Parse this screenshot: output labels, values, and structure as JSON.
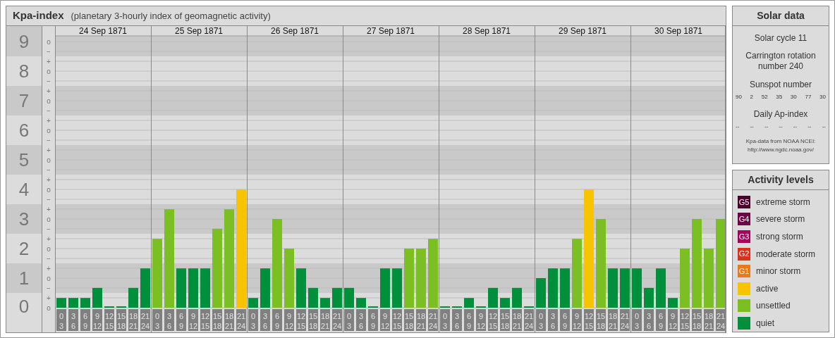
{
  "main_panel": {
    "title": "Kpa-index",
    "subtitle": "(planetary 3-hourly index of geomagnetic activity)",
    "minor_tick_labels": [
      "o",
      "−",
      "+",
      "o",
      "−",
      "+",
      "o",
      "−",
      "+",
      "o",
      "−",
      "+",
      "o",
      "−",
      "+",
      "o",
      "−",
      "+",
      "o",
      "−",
      "+",
      "o",
      "−",
      "+",
      "o",
      "−",
      "+",
      "o"
    ],
    "day_labels": [
      "24 Sep 1871",
      "25 Sep 1871",
      "26 Sep 1871",
      "27 Sep 1871",
      "28 Sep 1871",
      "29 Sep 1871",
      "30 Sep 1871"
    ],
    "chart_data": {
      "type": "bar",
      "stacked": true,
      "ylim": [
        0,
        9
      ],
      "yticks": [
        0,
        1,
        2,
        3,
        4,
        5,
        6,
        7,
        8,
        9
      ],
      "grid": true,
      "categories": [
        "0 3",
        "3 6",
        "6 9",
        "9 12",
        "12 15",
        "15 18",
        "18 21",
        "21 24",
        "0 3",
        "3 6",
        "6 9",
        "9 12",
        "12 15",
        "15 18",
        "18 21",
        "21 24",
        "0 3",
        "3 6",
        "6 9",
        "9 12",
        "12 15",
        "15 18",
        "18 21",
        "21 24",
        "0 3",
        "3 6",
        "6 9",
        "9 12",
        "12 15",
        "15 18",
        "18 21",
        "21 24",
        "0 3",
        "3 6",
        "6 9",
        "9 12",
        "12 15",
        "15 18",
        "18 21",
        "21 24",
        "0 3",
        "3 6",
        "6 9",
        "9 12",
        "12 15",
        "15 18",
        "18 21",
        "21 24",
        "0 3",
        "3 6",
        "6 9",
        "9 12",
        "12 15",
        "15 18",
        "18 21",
        "21 24"
      ],
      "series": [
        {
          "color": "#00903c",
          "values": [
            0.33,
            0.33,
            0.33,
            0.67,
            0,
            0,
            0.67,
            1.33,
            null,
            null,
            1.33,
            1.33,
            1.33,
            null,
            null,
            null,
            0.33,
            1.33,
            null,
            null,
            1.33,
            0.67,
            0.33,
            0.67,
            0.67,
            0.33,
            0,
            1.33,
            1.33,
            null,
            null,
            null,
            0,
            0,
            0.33,
            0,
            0.67,
            0.33,
            0.67,
            0,
            1,
            1.33,
            1.33,
            null,
            null,
            null,
            1.33,
            1.33,
            1.33,
            0.67,
            1.33,
            0.33,
            null,
            null,
            null,
            null
          ]
        },
        {
          "color": "#7cbf22",
          "values": [
            null,
            null,
            null,
            null,
            null,
            null,
            null,
            null,
            2.33,
            3.33,
            null,
            null,
            null,
            2.67,
            3.33,
            null,
            null,
            null,
            3,
            2,
            null,
            null,
            null,
            null,
            null,
            null,
            null,
            null,
            null,
            2,
            2,
            2.33,
            null,
            null,
            null,
            null,
            null,
            null,
            null,
            null,
            null,
            null,
            null,
            2.33,
            null,
            3,
            null,
            null,
            null,
            null,
            null,
            null,
            2,
            3,
            2,
            3
          ]
        },
        {
          "color": "#f8c400",
          "values": [
            null,
            null,
            null,
            null,
            null,
            null,
            null,
            null,
            null,
            null,
            null,
            null,
            null,
            null,
            null,
            4,
            null,
            null,
            null,
            null,
            null,
            null,
            null,
            null,
            null,
            null,
            null,
            null,
            null,
            null,
            null,
            null,
            null,
            null,
            null,
            null,
            null,
            null,
            null,
            null,
            null,
            null,
            null,
            null,
            4,
            null,
            null,
            null,
            null,
            null,
            null,
            null,
            null,
            null,
            null,
            null
          ]
        }
      ]
    }
  },
  "solar_data": {
    "title": "Solar data",
    "solar_cycle": "Solar cycle 11",
    "carrington": "Carrington rotation number 240",
    "sunspot_title": "Sunspot number",
    "sunspot_numbers": [
      "90",
      "2",
      "52",
      "35",
      "30",
      "77",
      "30"
    ],
    "ap_title": "Daily Ap-index",
    "ap_values": [
      "--",
      "--",
      "--",
      "--",
      "--",
      "--",
      "--"
    ],
    "source": "Kpa-data from NOAA NCEI:",
    "source_url": "http://www.ngdc.noaa.gov/"
  },
  "activity_levels": {
    "title": "Activity levels",
    "items": [
      {
        "badge": "G5",
        "label": "extreme storm",
        "color": "#4a0029"
      },
      {
        "badge": "G4",
        "label": "severe storm",
        "color": "#6e0345"
      },
      {
        "badge": "G3",
        "label": "strong storm",
        "color": "#a5005b"
      },
      {
        "badge": "G2",
        "label": "moderate storm",
        "color": "#d8321c"
      },
      {
        "badge": "G1",
        "label": "minor storm",
        "color": "#e87a1c"
      },
      {
        "label": "active",
        "color": "#f8c400"
      },
      {
        "label": "unsettled",
        "color": "#7cbf22"
      },
      {
        "label": "quiet",
        "color": "#00903c"
      }
    ]
  }
}
